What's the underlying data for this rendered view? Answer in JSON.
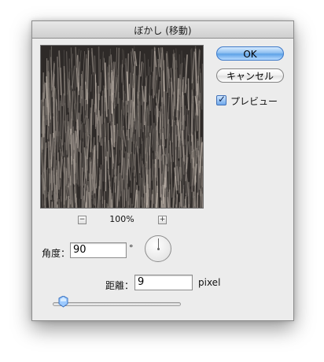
{
  "window": {
    "title": "ぼかし (移動)"
  },
  "preview": {
    "zoom_level": "100%",
    "zoom_out_label": "−",
    "zoom_in_label": "+"
  },
  "buttons": {
    "ok_label": "OK",
    "cancel_label": "キャンセル"
  },
  "options": {
    "preview_label": "プレビュー",
    "preview_checked": true
  },
  "controls": {
    "angle_label": "角度：",
    "angle_value": "90",
    "degree_symbol": "°",
    "distance_label": "距離：",
    "distance_value": "9",
    "distance_unit": "pixel",
    "distance_slider_fraction": 0.04
  },
  "colors": {
    "accent_blue": "#5ea2e8",
    "dialog_background": "#ececec"
  },
  "icons": {
    "checkmark": "checkmark-icon",
    "angle_dial": "angle-dial-icon",
    "slider_thumb": "slider-thumb-icon"
  }
}
